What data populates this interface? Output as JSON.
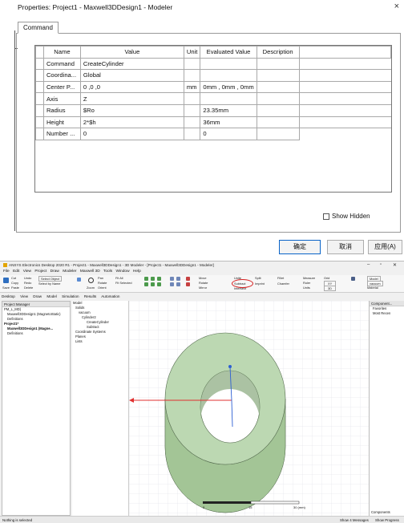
{
  "dialog": {
    "title": "Properties: Project1 - Maxwell3DDesign1 - Modeler",
    "close_glyph": "×",
    "tab": "Command",
    "columns": [
      "Name",
      "Value",
      "Unit",
      "Evaluated Value",
      "Description"
    ],
    "rows": [
      {
        "name": "Command",
        "value": "CreateCylinder",
        "unit": "",
        "evaluated": "",
        "description": ""
      },
      {
        "name": "Coordina...",
        "value": "Global",
        "unit": "",
        "evaluated": "",
        "description": ""
      },
      {
        "name": "Center P...",
        "value": "0 ,0 ,0",
        "unit": "mm",
        "evaluated": "0mm , 0mm , 0mm",
        "description": ""
      },
      {
        "name": "Axis",
        "value": "Z",
        "unit": "",
        "evaluated": "",
        "description": ""
      },
      {
        "name": "Radius",
        "value": "$Ro",
        "unit": "",
        "evaluated": "23.35mm",
        "description": ""
      },
      {
        "name": "Height",
        "value": "2*$h",
        "unit": "",
        "evaluated": "36mm",
        "description": ""
      },
      {
        "name": "Number ...",
        "value": "0",
        "unit": "",
        "evaluated": "0",
        "description": ""
      }
    ],
    "show_hidden_label": "Show Hidden",
    "buttons": {
      "ok": "确定",
      "cancel": "取消",
      "apply": "应用(A)"
    }
  },
  "app": {
    "title": "ANSYS Electronics Desktop 2020 R1 - Project1 - Maxwell3DDesign1 - 3D Modeler - [Project1 - Maxwell3DDesign1 - Modeler]",
    "menu": [
      "File",
      "Edit",
      "View",
      "Project",
      "Draw",
      "Modeler",
      "Maxwell 3D",
      "Tools",
      "Window",
      "Help"
    ],
    "ribbon": {
      "save": "Save",
      "cut": "Cut",
      "copy": "Copy",
      "paste": "Paste",
      "undo": "Undo",
      "redo": "Redo",
      "delete": "Delete",
      "select_object": "Select Object",
      "select_by_name": "Select by Name",
      "pan": "Pan",
      "rotate": "Rotate",
      "orient": "Orient",
      "zoom": "Zoom",
      "fit_all": "Fit All",
      "fit_selected": "Fit Selected",
      "move": "Move",
      "rotate_op": "Rotate",
      "mirror": "Mirror",
      "unite": "Unite",
      "subtract": "Subtract",
      "intersect": "Intersect",
      "split": "Split",
      "imprint": "Imprint",
      "fillet": "Fillet",
      "chamfer": "Chamfer",
      "measure": "Measure",
      "ruler": "Ruler",
      "units": "Units",
      "grid": "Grid",
      "grid_value_1": "XY",
      "grid_value_2": "3D",
      "model": "Model",
      "vacuum": "vacuum",
      "material": "Material"
    },
    "tabs": [
      "Desktop",
      "View",
      "Draw",
      "Model",
      "Simulation",
      "Results",
      "Automation"
    ],
    "project_manager": {
      "title": "Project Manager",
      "items": [
        "PM_L_MD)",
        "Maxwell3DDesign1 (MagnetoStatic)",
        "Definitions",
        "Project1*",
        "Maxwell3DDesign1 (Magne...",
        "Definitions"
      ]
    },
    "modeler_tree": [
      "Model",
      "Solids",
      "vacuum",
      "Cylinder2",
      "CreateCylinder",
      "Subtract",
      "Coordinate Systems",
      "Planes",
      "Lists"
    ],
    "components": {
      "title": "Component...",
      "items": [
        "Favorites",
        "Most Recen"
      ],
      "footer": "Components"
    },
    "status": {
      "left": "Nothing is selected",
      "messages": "Show 4 Messages",
      "progress": "Show Progress"
    },
    "scale": {
      "ticks": [
        "0",
        "15",
        "30 (mm)"
      ]
    }
  },
  "colors": {
    "ring_face": "#bcd8b2",
    "ring_side": "#a3c596",
    "highlight": "#d52020",
    "axis_x": "#e03030",
    "axis_z": "#2d5fd3"
  }
}
